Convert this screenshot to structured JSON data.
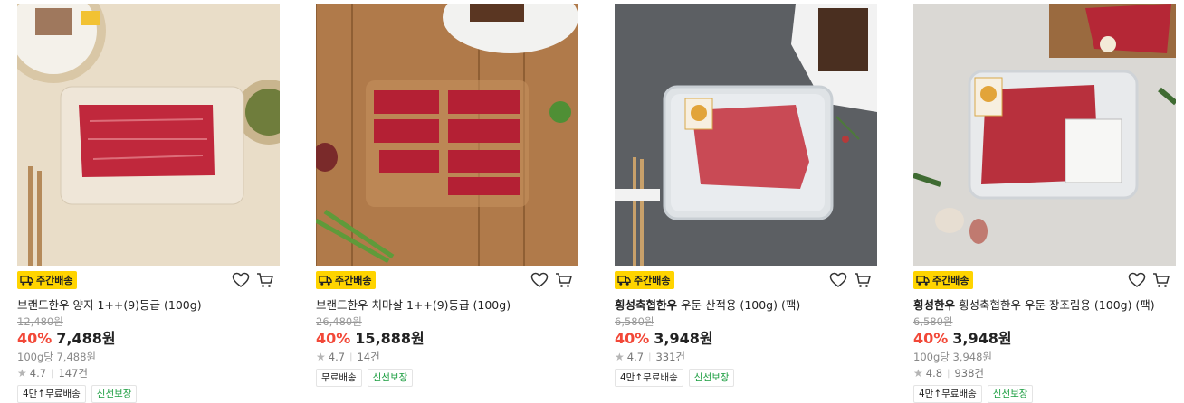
{
  "badge_label": "주간배송",
  "colors": {
    "discount": "#f24838",
    "badge_bg": "#ffd400",
    "fresh_tag": "#1a9d3f"
  },
  "products": [
    {
      "brand": "",
      "name": "브랜드한우 양지 1++(9)등급 (100g)",
      "original_price": "12,480원",
      "discount": "40%",
      "price": "7,488원",
      "unit_price": "100g당 7,488원",
      "rating": "4.7",
      "reviews": "147건",
      "tags": [
        "4만↑무료배송",
        "신선보장"
      ]
    },
    {
      "brand": "",
      "name": "브랜드한우 치마살 1++(9)등급 (100g)",
      "original_price": "26,480원",
      "discount": "40%",
      "price": "15,888원",
      "rating": "4.7",
      "reviews": "14건",
      "tags": [
        "무료배송",
        "신선보장"
      ]
    },
    {
      "brand": "횡성축협한우",
      "name": " 우둔 산적용 (100g) (팩)",
      "original_price": "6,580원",
      "discount": "40%",
      "price": "3,948원",
      "rating": "4.7",
      "reviews": "331건",
      "tags": [
        "4만↑무료배송",
        "신선보장"
      ]
    },
    {
      "brand": "횡성한우",
      "name": " 횡성축협한우 우둔 장조림용 (100g) (팩)",
      "original_price": "6,580원",
      "discount": "40%",
      "price": "3,948원",
      "unit_price": "100g당 3,948원",
      "rating": "4.8",
      "reviews": "938건",
      "tags": [
        "4만↑무료배송",
        "신선보장"
      ]
    }
  ]
}
